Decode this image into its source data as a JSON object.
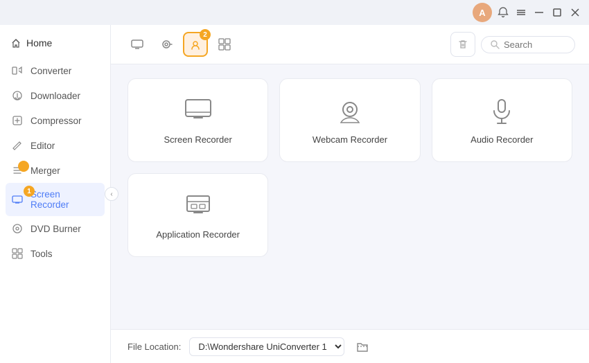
{
  "titlebar": {
    "user_initial": "A",
    "bell_label": "notifications",
    "menu_label": "menu",
    "minimize_label": "minimize",
    "maximize_label": "maximize",
    "close_label": "close"
  },
  "sidebar": {
    "home_label": "Home",
    "items": [
      {
        "id": "converter",
        "label": "Converter",
        "active": false,
        "badge": null
      },
      {
        "id": "downloader",
        "label": "Downloader",
        "active": false,
        "badge": null
      },
      {
        "id": "compressor",
        "label": "Compressor",
        "active": false,
        "badge": null
      },
      {
        "id": "editor",
        "label": "Editor",
        "active": false,
        "badge": null
      },
      {
        "id": "merger",
        "label": "Merger",
        "active": false,
        "badge": null
      },
      {
        "id": "screen-recorder",
        "label": "Screen Recorder",
        "active": true,
        "badge": "1"
      },
      {
        "id": "dvd-burner",
        "label": "DVD Burner",
        "active": false,
        "badge": null
      },
      {
        "id": "tools",
        "label": "Tools",
        "active": false,
        "badge": null
      }
    ]
  },
  "toolbar": {
    "buttons": [
      {
        "id": "screen",
        "label": "Screen"
      },
      {
        "id": "webcam",
        "label": "Webcam"
      },
      {
        "id": "app-recorder",
        "label": "Application Recorder",
        "active": true,
        "badge": "2"
      },
      {
        "id": "more",
        "label": "More"
      }
    ],
    "search_placeholder": "Search"
  },
  "cards": [
    {
      "id": "screen-recorder",
      "label": "Screen Recorder"
    },
    {
      "id": "webcam-recorder",
      "label": "Webcam Recorder"
    },
    {
      "id": "audio-recorder",
      "label": "Audio Recorder"
    },
    {
      "id": "application-recorder",
      "label": "Application Recorder"
    }
  ],
  "footer": {
    "file_location_label": "File Location:",
    "path_value": "D:\\Wondershare UniConverter 1",
    "path_options": [
      "D:\\Wondershare UniConverter 1"
    ]
  }
}
